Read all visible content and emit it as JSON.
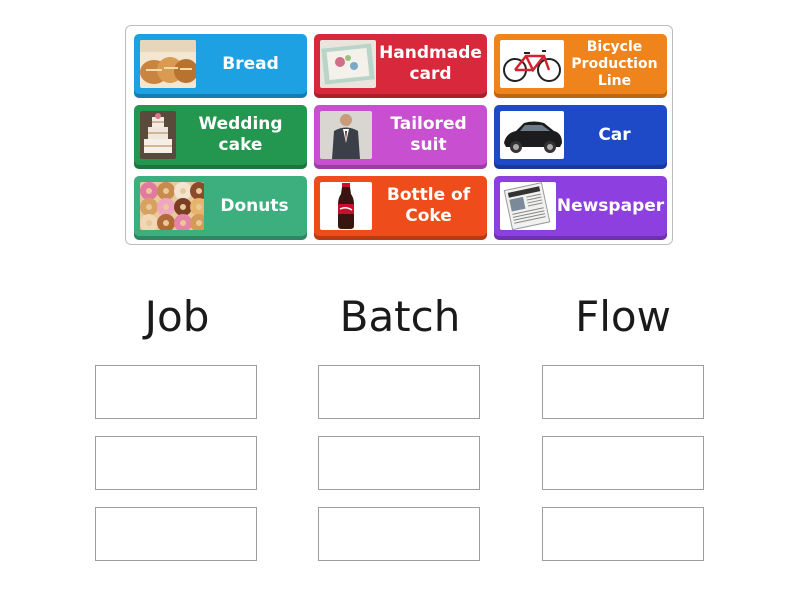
{
  "tiles": [
    {
      "label": "Bread",
      "color": "#1da1e2",
      "icon": "bread-image"
    },
    {
      "label": "Handmade card",
      "color": "#d8283b",
      "icon": "handmade-card-image"
    },
    {
      "label": "Bicycle Production Line",
      "color": "#f0841c",
      "icon": "bicycle-image"
    },
    {
      "label": "Wedding cake",
      "color": "#23964f",
      "icon": "wedding-cake-image"
    },
    {
      "label": "Tailored suit",
      "color": "#c74fd0",
      "icon": "tailored-suit-image"
    },
    {
      "label": "Car",
      "color": "#1f4ac7",
      "icon": "car-image"
    },
    {
      "label": "Donuts",
      "color": "#3dae7e",
      "icon": "donuts-image"
    },
    {
      "label": "Bottle of Coke",
      "color": "#ee4c1a",
      "icon": "coke-bottle-image"
    },
    {
      "label": "Newspaper",
      "color": "#8e3fe0",
      "icon": "newspaper-image"
    }
  ],
  "columns": [
    {
      "title": "Job"
    },
    {
      "title": "Batch"
    },
    {
      "title": "Flow"
    }
  ]
}
